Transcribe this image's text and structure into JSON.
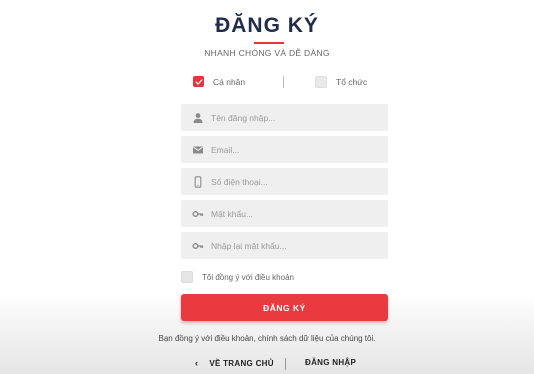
{
  "header": {
    "title": "ĐĂNG KÝ",
    "subtitle": "NHANH CHÓNG VÀ DỄ DÀNG",
    "accent_color": "#e0373d"
  },
  "account_type": {
    "individual_label": "Cá nhân",
    "individual_checked": true,
    "organization_label": "Tổ chức",
    "organization_checked": false
  },
  "fields": {
    "username": {
      "placeholder": "Tên đăng nhập...",
      "value": "",
      "icon": "user-icon"
    },
    "email": {
      "placeholder": "Email...",
      "value": "",
      "icon": "mail-icon"
    },
    "phone": {
      "placeholder": "Số điện thoại...",
      "value": "",
      "icon": "phone-icon"
    },
    "password": {
      "placeholder": "Mật khẩu...",
      "value": "",
      "icon": "key-icon"
    },
    "confirm_password": {
      "placeholder": "Nhập lại mật khẩu...",
      "value": "",
      "icon": "key-icon"
    }
  },
  "terms": {
    "label": "Tôi đồng ý với điều khoản",
    "checked": false
  },
  "submit": {
    "label": "ĐĂNG KÝ",
    "color": "#e93b3f"
  },
  "agreement_text": "Bạn đồng ý với điều khoản, chính sách dữ liệu của chúng tôi.",
  "footer": {
    "back_home_label": "VỀ TRANG CHỦ",
    "back_icon": "chevron-left-icon",
    "login_label": "ĐĂNG NHẬP"
  }
}
